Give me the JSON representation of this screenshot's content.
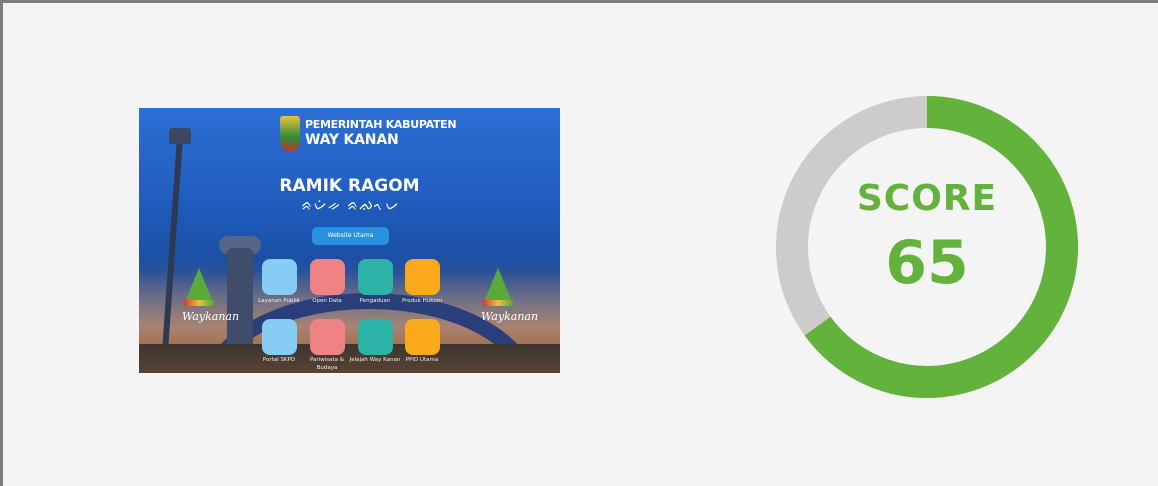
{
  "screenshot": {
    "header_line1": "PEMERINTAH KABUPATEN",
    "header_line2": "WAY KANAN",
    "title": "RAMIK RAGOM",
    "script_text": "ᨑᨆᨗᨀ ᨑᨁᨚᨆ",
    "main_button": "Website Utama",
    "side_logo_text": "Waykanan",
    "tiles": [
      {
        "label": "Layanan Publik",
        "color": "#86ccf5"
      },
      {
        "label": "Open Data",
        "color": "#ef8383"
      },
      {
        "label": "Pengaduan",
        "color": "#2ab3a6"
      },
      {
        "label": "Produk Hukum",
        "color": "#fba91c"
      },
      {
        "label": "Portal SKPD",
        "color": "#86ccf5"
      },
      {
        "label": "Pariwisata & Budaya",
        "color": "#ef8383"
      },
      {
        "label": "Jelajah Way Kanan",
        "color": "#2ab3a6"
      },
      {
        "label": "PPID Utama",
        "color": "#fba91c"
      }
    ]
  },
  "score": {
    "label": "SCORE",
    "value": 65,
    "color": "#62b23b",
    "track_color": "#cccccc"
  }
}
